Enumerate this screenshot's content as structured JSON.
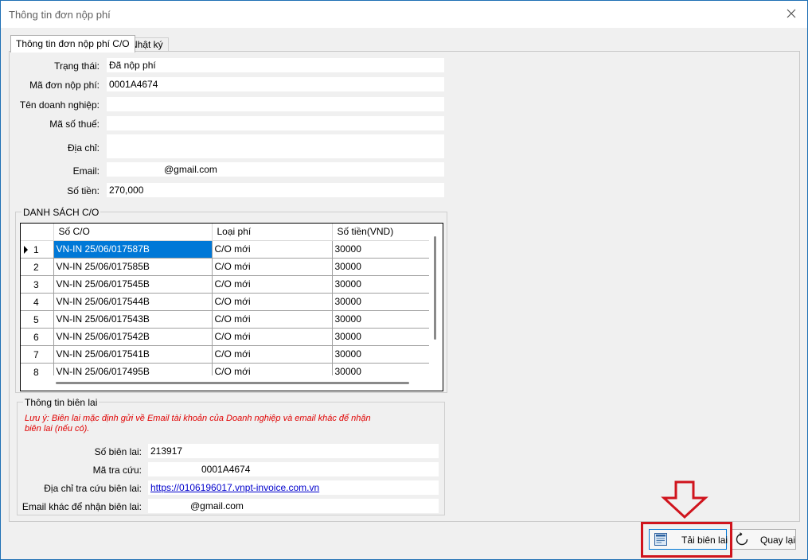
{
  "window": {
    "title": "Thông tin đơn nộp phí",
    "close_icon": "close-icon"
  },
  "tabs": [
    {
      "label": "Thông tin đơn nộp phí C/O",
      "active": true
    },
    {
      "label": "Nhật ký",
      "active": false
    }
  ],
  "form": {
    "status_label": "Trạng thái:",
    "status_value": "Đã nộp phí",
    "code_label": "Mã đơn nộp phí:",
    "code_value": "0001A4674",
    "company_label": "Tên doanh nghiệp:",
    "company_value": "",
    "tax_label": "Mã số thuế:",
    "tax_value": "",
    "address_label": "Địa chỉ:",
    "address_value": "",
    "email_label": "Email:",
    "email_value": "@gmail.com",
    "amount_label": "Số tiền:",
    "amount_value": "270,000"
  },
  "co_list": {
    "title": "DANH SÁCH C/O",
    "columns": [
      "Số C/O",
      "Loại phí",
      "Số tiền(VND)"
    ],
    "rows": [
      {
        "num": "1",
        "so_co": "VN-IN 25/06/017587B",
        "loai_phi": "C/O mới",
        "so_tien": "30000"
      },
      {
        "num": "2",
        "so_co": "VN-IN 25/06/017585B",
        "loai_phi": "C/O mới",
        "so_tien": "30000"
      },
      {
        "num": "3",
        "so_co": "VN-IN 25/06/017545B",
        "loai_phi": "C/O mới",
        "so_tien": "30000"
      },
      {
        "num": "4",
        "so_co": "VN-IN 25/06/017544B",
        "loai_phi": "C/O mới",
        "so_tien": "30000"
      },
      {
        "num": "5",
        "so_co": "VN-IN 25/06/017543B",
        "loai_phi": "C/O mới",
        "so_tien": "30000"
      },
      {
        "num": "6",
        "so_co": "VN-IN 25/06/017542B",
        "loai_phi": "C/O mới",
        "so_tien": "30000"
      },
      {
        "num": "7",
        "so_co": "VN-IN 25/06/017541B",
        "loai_phi": "C/O mới",
        "so_tien": "30000"
      },
      {
        "num": "8",
        "so_co": "VN-IN 25/06/017495B",
        "loai_phi": "C/O mới",
        "so_tien": "30000"
      }
    ]
  },
  "receipt": {
    "title": "Thông tin biên lai",
    "note": "Lưu ý: Biên lai mặc định gửi về Email tài khoản của Doanh nghiệp và email khác để nhận biên lai (nếu có).",
    "number_label": "Số biên lai:",
    "number_value": "213917",
    "lookup_label": "Mã tra cứu:",
    "lookup_value": "0001A4674",
    "url_label": "Địa chỉ tra cứu biên lai:",
    "url_value": "https://0106196017.vnpt-invoice.com.vn",
    "other_email_label": "Email khác để nhận biên lai:",
    "other_email_value": "@gmail.com"
  },
  "buttons": {
    "download_label": "Tải biên lai",
    "download_icon": "receipt-icon",
    "back_label": "Quay lại",
    "back_icon": "refresh-icon"
  },
  "colors": {
    "selection": "#0078d7",
    "highlight": "#d0141d",
    "note": "#e00000",
    "link": "#0000cc"
  }
}
